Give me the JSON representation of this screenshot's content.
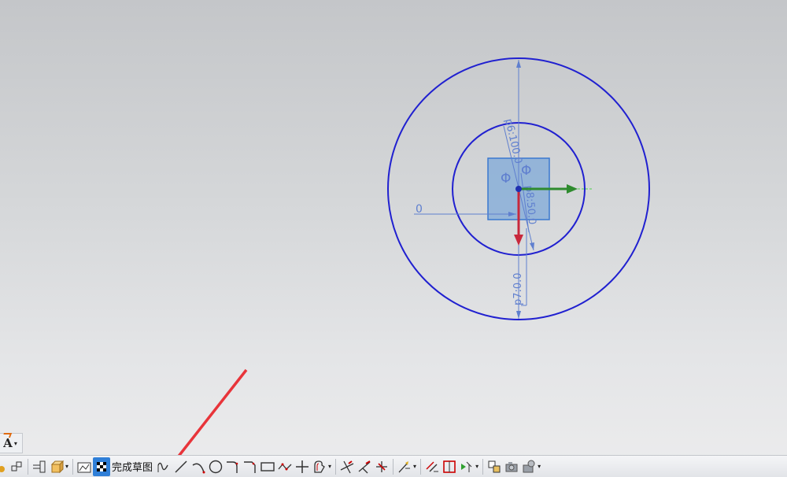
{
  "canvas": {
    "dimensions": {
      "outer_circle_diameter": "p7:0.0",
      "inner_circle_diameter": "p6:100.0",
      "diameter_symbol": "Φ",
      "square_side": "p8:50.0",
      "offset": "0"
    },
    "colors": {
      "sketch_curve": "#2020d0",
      "dimension": "#5f7fcf",
      "x_axis": "#2e8b2e",
      "y_axis": "#c8283c",
      "annotation_arrow": "#e8343a"
    }
  },
  "left_panel": {
    "text_tool": "A"
  },
  "toolbar": {
    "finish_sketch_label": "完成草图",
    "icons": [
      "fillet-icon",
      "snap-icon",
      "pattern-icon",
      "box-view-icon",
      "sketch-task-icon",
      "finish-flag-icon",
      "studio-spline-icon",
      "line-icon",
      "arc-icon",
      "circle-icon",
      "fillet-curve-icon",
      "chamfer-icon",
      "rectangle-icon",
      "polyline-icon",
      "point-icon",
      "offset-curve-icon",
      "quick-trim-icon",
      "quick-extend-icon",
      "make-corner-icon",
      "auto-dimension-icon",
      "geometric-constraint-icon",
      "coincident-icon",
      "show-constraints-icon",
      "display-sketch-icon",
      "camera-icon",
      "render-icon"
    ]
  }
}
